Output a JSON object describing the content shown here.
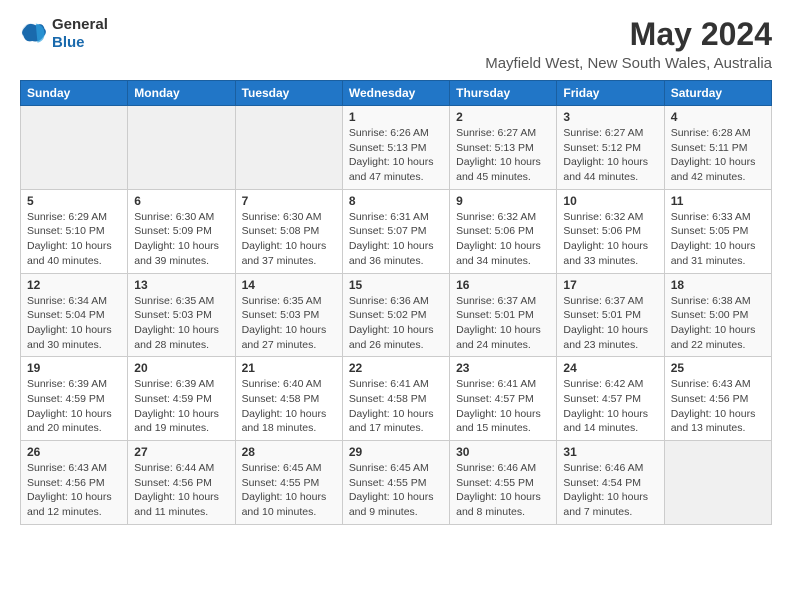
{
  "header": {
    "logo_general": "General",
    "logo_blue": "Blue",
    "title": "May 2024",
    "subtitle": "Mayfield West, New South Wales, Australia"
  },
  "calendar": {
    "days_of_week": [
      "Sunday",
      "Monday",
      "Tuesday",
      "Wednesday",
      "Thursday",
      "Friday",
      "Saturday"
    ],
    "weeks": [
      [
        {
          "day": "",
          "info": ""
        },
        {
          "day": "",
          "info": ""
        },
        {
          "day": "",
          "info": ""
        },
        {
          "day": "1",
          "info": "Sunrise: 6:26 AM\nSunset: 5:13 PM\nDaylight: 10 hours and 47 minutes."
        },
        {
          "day": "2",
          "info": "Sunrise: 6:27 AM\nSunset: 5:13 PM\nDaylight: 10 hours and 45 minutes."
        },
        {
          "day": "3",
          "info": "Sunrise: 6:27 AM\nSunset: 5:12 PM\nDaylight: 10 hours and 44 minutes."
        },
        {
          "day": "4",
          "info": "Sunrise: 6:28 AM\nSunset: 5:11 PM\nDaylight: 10 hours and 42 minutes."
        }
      ],
      [
        {
          "day": "5",
          "info": "Sunrise: 6:29 AM\nSunset: 5:10 PM\nDaylight: 10 hours and 40 minutes."
        },
        {
          "day": "6",
          "info": "Sunrise: 6:30 AM\nSunset: 5:09 PM\nDaylight: 10 hours and 39 minutes."
        },
        {
          "day": "7",
          "info": "Sunrise: 6:30 AM\nSunset: 5:08 PM\nDaylight: 10 hours and 37 minutes."
        },
        {
          "day": "8",
          "info": "Sunrise: 6:31 AM\nSunset: 5:07 PM\nDaylight: 10 hours and 36 minutes."
        },
        {
          "day": "9",
          "info": "Sunrise: 6:32 AM\nSunset: 5:06 PM\nDaylight: 10 hours and 34 minutes."
        },
        {
          "day": "10",
          "info": "Sunrise: 6:32 AM\nSunset: 5:06 PM\nDaylight: 10 hours and 33 minutes."
        },
        {
          "day": "11",
          "info": "Sunrise: 6:33 AM\nSunset: 5:05 PM\nDaylight: 10 hours and 31 minutes."
        }
      ],
      [
        {
          "day": "12",
          "info": "Sunrise: 6:34 AM\nSunset: 5:04 PM\nDaylight: 10 hours and 30 minutes."
        },
        {
          "day": "13",
          "info": "Sunrise: 6:35 AM\nSunset: 5:03 PM\nDaylight: 10 hours and 28 minutes."
        },
        {
          "day": "14",
          "info": "Sunrise: 6:35 AM\nSunset: 5:03 PM\nDaylight: 10 hours and 27 minutes."
        },
        {
          "day": "15",
          "info": "Sunrise: 6:36 AM\nSunset: 5:02 PM\nDaylight: 10 hours and 26 minutes."
        },
        {
          "day": "16",
          "info": "Sunrise: 6:37 AM\nSunset: 5:01 PM\nDaylight: 10 hours and 24 minutes."
        },
        {
          "day": "17",
          "info": "Sunrise: 6:37 AM\nSunset: 5:01 PM\nDaylight: 10 hours and 23 minutes."
        },
        {
          "day": "18",
          "info": "Sunrise: 6:38 AM\nSunset: 5:00 PM\nDaylight: 10 hours and 22 minutes."
        }
      ],
      [
        {
          "day": "19",
          "info": "Sunrise: 6:39 AM\nSunset: 4:59 PM\nDaylight: 10 hours and 20 minutes."
        },
        {
          "day": "20",
          "info": "Sunrise: 6:39 AM\nSunset: 4:59 PM\nDaylight: 10 hours and 19 minutes."
        },
        {
          "day": "21",
          "info": "Sunrise: 6:40 AM\nSunset: 4:58 PM\nDaylight: 10 hours and 18 minutes."
        },
        {
          "day": "22",
          "info": "Sunrise: 6:41 AM\nSunset: 4:58 PM\nDaylight: 10 hours and 17 minutes."
        },
        {
          "day": "23",
          "info": "Sunrise: 6:41 AM\nSunset: 4:57 PM\nDaylight: 10 hours and 15 minutes."
        },
        {
          "day": "24",
          "info": "Sunrise: 6:42 AM\nSunset: 4:57 PM\nDaylight: 10 hours and 14 minutes."
        },
        {
          "day": "25",
          "info": "Sunrise: 6:43 AM\nSunset: 4:56 PM\nDaylight: 10 hours and 13 minutes."
        }
      ],
      [
        {
          "day": "26",
          "info": "Sunrise: 6:43 AM\nSunset: 4:56 PM\nDaylight: 10 hours and 12 minutes."
        },
        {
          "day": "27",
          "info": "Sunrise: 6:44 AM\nSunset: 4:56 PM\nDaylight: 10 hours and 11 minutes."
        },
        {
          "day": "28",
          "info": "Sunrise: 6:45 AM\nSunset: 4:55 PM\nDaylight: 10 hours and 10 minutes."
        },
        {
          "day": "29",
          "info": "Sunrise: 6:45 AM\nSunset: 4:55 PM\nDaylight: 10 hours and 9 minutes."
        },
        {
          "day": "30",
          "info": "Sunrise: 6:46 AM\nSunset: 4:55 PM\nDaylight: 10 hours and 8 minutes."
        },
        {
          "day": "31",
          "info": "Sunrise: 6:46 AM\nSunset: 4:54 PM\nDaylight: 10 hours and 7 minutes."
        },
        {
          "day": "",
          "info": ""
        }
      ]
    ]
  }
}
